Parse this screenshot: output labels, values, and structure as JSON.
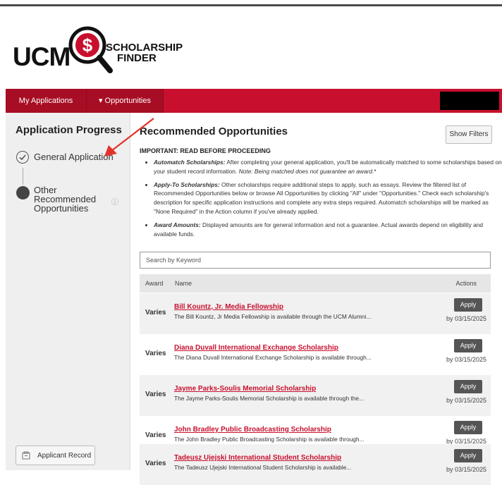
{
  "logo": {
    "ucm": "UCM",
    "symbol": "$",
    "line1": "SCHOLARSHIP",
    "line2": "FINDER"
  },
  "nav": {
    "my_applications": "My Applications",
    "opportunities": "▾ Opportunities"
  },
  "sidebar": {
    "title": "Application Progress",
    "steps": [
      {
        "label": "General Application",
        "state": "completed"
      },
      {
        "label": "Other Recommended Opportunities",
        "state": "pending"
      }
    ],
    "info_icon": "ⓘ",
    "applicant_record": "Applicant Record"
  },
  "main": {
    "title": "Recommended Opportunities",
    "show_filters": "Show Filters",
    "important": "IMPORTANT: READ BEFORE PROCEEDING",
    "bullets": [
      {
        "head": "Automatch Scholarships:",
        "text": " After completing your general application, you'll be automatically matched to some scholarships based on your student record information. ",
        "note": "Note: Being matched does not guarantee an award.",
        "tail": "*"
      },
      {
        "head": "Apply-To Scholarships:",
        "text": " Other scholarships require additional steps to apply, such as essays. Review the filtered list of Recommended Opportunities below or browse All Opportunities by clicking \"All\" under \"Opportunities.\" Check each scholarship's description for specific application instructions and complete any extra steps required. Automatch scholarships will be marked as \"None Required\" in the Action column if you've already applied."
      },
      {
        "head": "Award Amounts:",
        "text": " Displayed amounts are for general information and not a guarantee. Actual awards depend on eligibility and available funds."
      }
    ],
    "search_placeholder": "Search by Keyword",
    "columns": {
      "award": "Award",
      "name": "Name",
      "actions": "Actions"
    },
    "rows": [
      {
        "award": "Varies",
        "name": "Bill Kountz, Jr. Media Fellowship",
        "desc": "The Bill Kountz, Jr Media Fellowship is available through the UCM Alumni...",
        "apply": "Apply",
        "due": "by 03/15/2025"
      },
      {
        "award": "Varies",
        "name": "Diana Duvall International Exchange Scholarship",
        "desc": "The Diana Duvall International Exchange Scholarship is available through...",
        "apply": "Apply",
        "due": "by 03/15/2025"
      },
      {
        "award": "Varies",
        "name": "Jayme Parks-Soulis Memorial Scholarship",
        "desc": "The Jayme Parks-Soulis Memorial Scholarship is available through the...",
        "apply": "Apply",
        "due": "by 03/15/2025"
      },
      {
        "award": "Varies",
        "name": "John Bradley Public Broadcasting Scholarship",
        "desc": "The John Bradley Public Broadcasting Scholarship is available through...",
        "apply": "Apply",
        "due": "by 03/15/2025"
      },
      {
        "award": "Varies",
        "name": "Tadeusz Ujejski International Student Scholarship",
        "desc": "The Tadeusz Ujejski International Student Scholarship is available...",
        "apply": "Apply",
        "due": "by 03/15/2025"
      }
    ]
  },
  "colors": {
    "brand_red": "#c8102e",
    "nav_dark": "#a70d24",
    "apply_button": "#555555"
  }
}
